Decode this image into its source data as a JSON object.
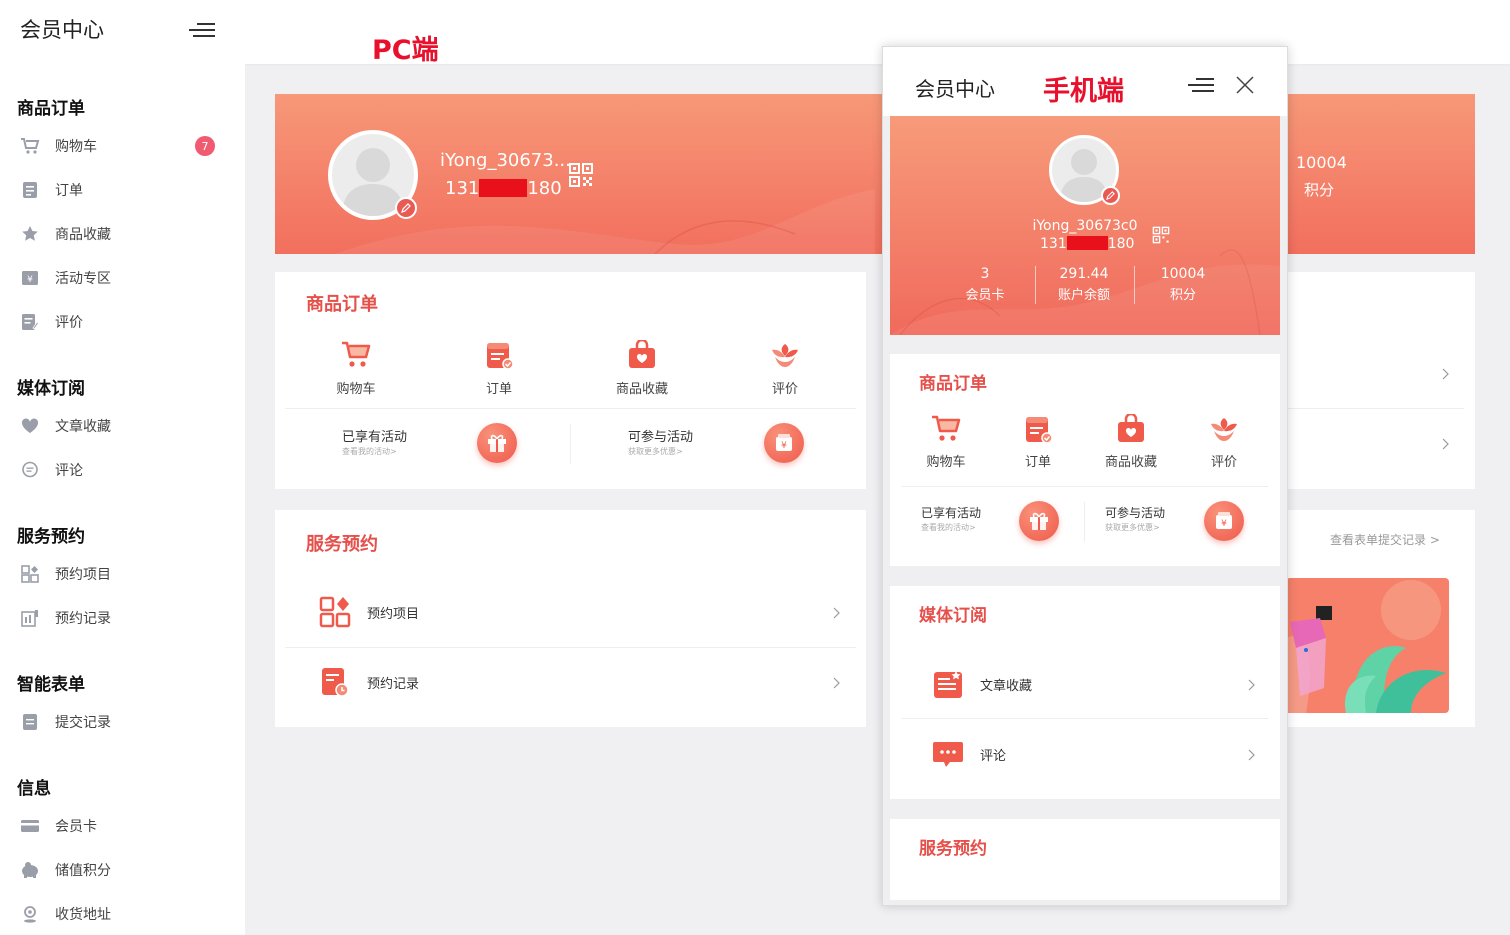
{
  "app": {
    "brand": "会员中心",
    "pc_label": "PC端",
    "mobile_label": "手机端"
  },
  "colors": {
    "accent": "#e5504a",
    "banner_top": "#f79878",
    "banner_bottom": "#f26f5e",
    "badge": "#f05b72",
    "mask": "#e8101b"
  },
  "sidebar": {
    "sections": [
      {
        "title": "商品订单",
        "items": [
          {
            "label": "购物车",
            "icon": "cart-icon",
            "badge": "7"
          },
          {
            "label": "订单",
            "icon": "order-icon"
          },
          {
            "label": "商品收藏",
            "icon": "star-icon"
          },
          {
            "label": "活动专区",
            "icon": "activity-icon"
          },
          {
            "label": "评价",
            "icon": "review-icon"
          }
        ]
      },
      {
        "title": "媒体订阅",
        "items": [
          {
            "label": "文章收藏",
            "icon": "heart-icon"
          },
          {
            "label": "评论",
            "icon": "comment-icon"
          }
        ]
      },
      {
        "title": "服务预约",
        "items": [
          {
            "label": "预约项目",
            "icon": "grid-icon"
          },
          {
            "label": "预约记录",
            "icon": "record-icon"
          }
        ]
      },
      {
        "title": "智能表单",
        "items": [
          {
            "label": "提交记录",
            "icon": "form-icon"
          }
        ]
      },
      {
        "title": "信息",
        "items": [
          {
            "label": "会员卡",
            "icon": "card-icon"
          },
          {
            "label": "储值积分",
            "icon": "points-icon"
          },
          {
            "label": "收货地址",
            "icon": "location-icon"
          }
        ]
      }
    ]
  },
  "profile": {
    "username": "iYong_30673...",
    "phone_prefix": "131",
    "phone_suffix": "180",
    "stats": [
      {
        "value": "10004",
        "label": "积分"
      }
    ]
  },
  "orders_card": {
    "title": "商品订单",
    "icons": [
      {
        "label": "购物车",
        "icon": "cart-icon"
      },
      {
        "label": "订单",
        "icon": "order-icon"
      },
      {
        "label": "商品收藏",
        "icon": "favorite-bag-icon"
      },
      {
        "label": "评价",
        "icon": "flower-icon"
      }
    ],
    "activities": [
      {
        "title": "已享有活动",
        "sub": "查看我的活动>",
        "icon": "gift-icon"
      },
      {
        "title": "可参与活动",
        "sub": "获取更多优惠>",
        "icon": "coupon-icon"
      }
    ]
  },
  "service_card": {
    "title": "服务预约",
    "rows": [
      {
        "label": "预约项目",
        "icon": "grid-icon"
      },
      {
        "label": "预约记录",
        "icon": "record-icon"
      }
    ]
  },
  "form_card": {
    "link": "查看表单提交记录 >"
  },
  "mobile": {
    "brand": "会员中心",
    "username": "iYong_30673c0",
    "phone_prefix": "131",
    "phone_suffix": "180",
    "stats": [
      {
        "value": "3",
        "label": "会员卡"
      },
      {
        "value": "291.44",
        "label": "账户余额"
      },
      {
        "value": "10004",
        "label": "积分"
      }
    ],
    "orders": {
      "title": "商品订单",
      "icons": [
        {
          "label": "购物车",
          "icon": "cart-icon"
        },
        {
          "label": "订单",
          "icon": "order-icon"
        },
        {
          "label": "商品收藏",
          "icon": "favorite-bag-icon"
        },
        {
          "label": "评价",
          "icon": "flower-icon"
        }
      ],
      "activities": [
        {
          "title": "已享有活动",
          "sub": "查看我的活动>"
        },
        {
          "title": "可参与活动",
          "sub": "获取更多优惠>"
        }
      ]
    },
    "media": {
      "title": "媒体订阅",
      "rows": [
        {
          "label": "文章收藏",
          "icon": "article-icon"
        },
        {
          "label": "评论",
          "icon": "chat-icon"
        }
      ]
    },
    "service": {
      "title": "服务预约"
    }
  }
}
